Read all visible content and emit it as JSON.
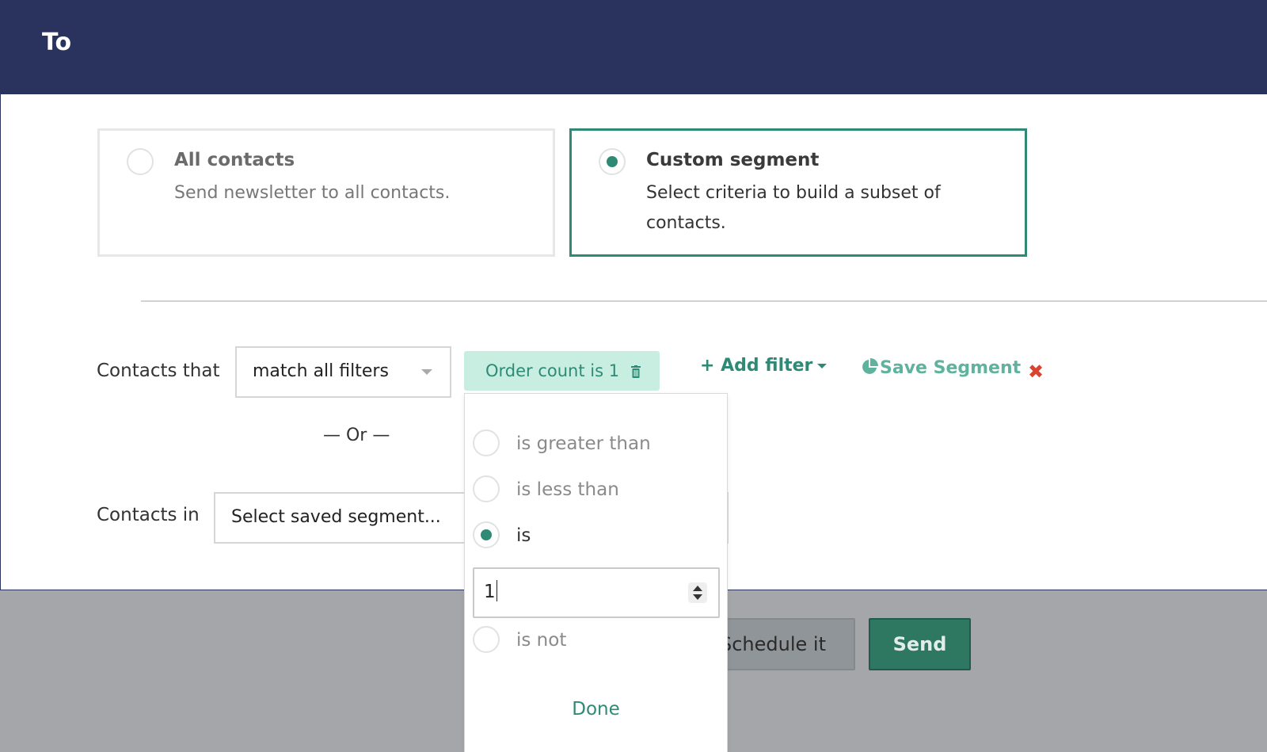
{
  "header": {
    "title": "To"
  },
  "audience": {
    "all": {
      "title": "All contacts",
      "description": "Send newsletter to all contacts.",
      "selected": false
    },
    "custom": {
      "title": "Custom segment",
      "description": "Select criteria to build a subset of contacts.",
      "selected": true
    }
  },
  "filters": {
    "contacts_that_label": "Contacts that",
    "match_select_value": "match all filters",
    "active_filter_chip": "Order count is 1",
    "add_filter_label": "+ Add filter",
    "save_segment_label": "Save Segment",
    "remove_icon": "✖",
    "or_label": "— Or —",
    "contacts_in_label": "Contacts in",
    "saved_segment_placeholder": "Select saved segment..."
  },
  "operator_dropdown": {
    "options": [
      {
        "label": "is greater than",
        "selected": false
      },
      {
        "label": "is less than",
        "selected": false
      },
      {
        "label": "is",
        "selected": true
      },
      {
        "label": "is not",
        "selected": false
      }
    ],
    "value_input": "1",
    "done_label": "Done"
  },
  "footer": {
    "schedule_label": "Schedule it",
    "send_label": "Send"
  },
  "colors": {
    "header_bg": "#2a335d",
    "accent_green": "#2f8a75",
    "chip_bg": "#c8eee2",
    "send_bg": "#2e7862",
    "remove_red": "#d9432f",
    "overlay_gray": "#a4a6a9"
  }
}
